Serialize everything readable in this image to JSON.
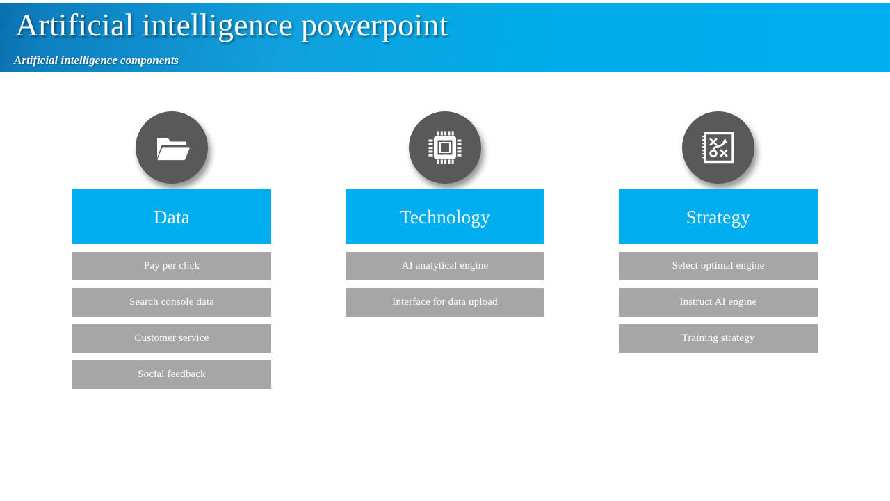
{
  "header": {
    "title": "Artificial intelligence powerpoint",
    "subtitle": "Artificial intelligence components",
    "gradient_left": "#0a6fae",
    "gradient_right": "#00aeef"
  },
  "colors": {
    "accent_blue": "#00aeef",
    "item_grey": "#a6a6a6",
    "circle_grey": "#595959",
    "text_white": "#ffffff",
    "background": "#ffffff"
  },
  "columns": [
    {
      "icon": "folder-open-icon",
      "title": "Data",
      "items": [
        "Pay per click",
        "Search console data",
        "Customer service",
        "Social feedback"
      ]
    },
    {
      "icon": "cpu-chip-icon",
      "title": "Technology",
      "items": [
        "AI analytical engine",
        "Interface for data upload"
      ]
    },
    {
      "icon": "strategy-playbook-icon",
      "title": "Strategy",
      "items": [
        "Select optimal engine",
        "Instruct AI engine",
        "Training strategy"
      ]
    }
  ]
}
